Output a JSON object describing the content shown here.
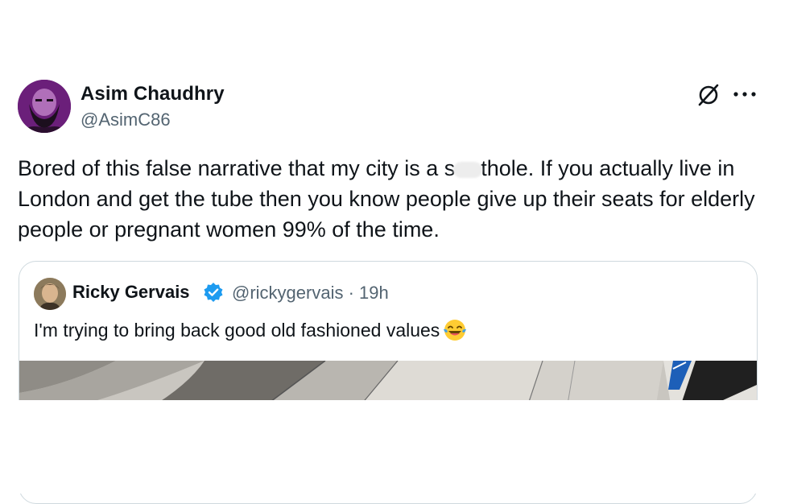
{
  "author": {
    "name": "Asim Chaudhry",
    "handle": "@AsimC86"
  },
  "icons": {
    "avatar": "avatar-bearded-man",
    "grok": "grok-slash-circle-icon",
    "more": "more-dots-icon",
    "verified": "verified-check-icon",
    "emoji": "laughing-tears-emoji"
  },
  "tweet": {
    "text_before": "Bored of this false narrative that my city is a s",
    "text_after": "thole. If you actually live in London and get the tube then you know people give up their seats for elderly people or pregnant women 99% of the time."
  },
  "quote": {
    "name": "Ricky Gervais",
    "handle": "@rickygervais",
    "separator": "·",
    "time": "19h",
    "text": "I'm trying to bring back good old fashioned values"
  },
  "colors": {
    "text": "#0f1419",
    "muted": "#536471",
    "border": "#cfd9de",
    "verified": "#1d9bf0",
    "avatar_bg": "#6b1f7a"
  }
}
